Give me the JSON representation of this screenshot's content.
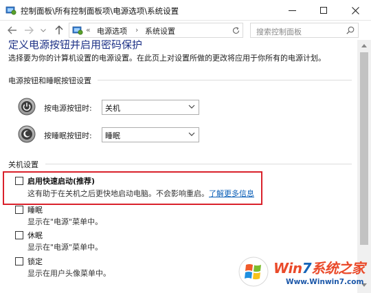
{
  "window": {
    "title": "控制面板\\所有控制面板项\\电源选项\\系统设置"
  },
  "address": {
    "prefix": "«",
    "crumbs": [
      "电源选项",
      "系统设置"
    ],
    "separator": "›"
  },
  "search": {
    "placeholder": "搜索控制面板"
  },
  "page": {
    "heading": "定义电源按钮并启用密码保护",
    "description": "选择要为你的计算机设置的电源设置。在此页上对设置所做的更改将应用于你所有的电源计划。"
  },
  "power_buttons": {
    "group_title": "电源按钮和睡眠按钮设置",
    "rows": [
      {
        "label": "按电源按钮时:",
        "value": "关机",
        "icon": "power-button-icon"
      },
      {
        "label": "按睡眠按钮时:",
        "value": "睡眠",
        "icon": "sleep-button-icon"
      }
    ]
  },
  "shutdown": {
    "group_title": "关机设置",
    "options": [
      {
        "label": "启用快速启动(推荐)",
        "desc": "这有助于在关机之后更快地启动电脑。不会影响重启。",
        "link": "了解更多信息",
        "checked": false
      },
      {
        "label": "睡眠",
        "desc": "显示在\"电源\"菜单中。",
        "checked": false
      },
      {
        "label": "休眠",
        "desc": "显示在\"电源\"菜单中。",
        "checked": false
      },
      {
        "label": "锁定",
        "desc": "显示在用户头像菜单中。",
        "checked": false
      }
    ]
  },
  "watermark": {
    "brand_a": "Win",
    "brand_b": "7",
    "brand_c": "系统之家",
    "url": "Www.Winwin7.com"
  },
  "colors": {
    "highlight_box": "#d9202a",
    "link": "#0b5fb7",
    "heading": "#1e3287"
  }
}
